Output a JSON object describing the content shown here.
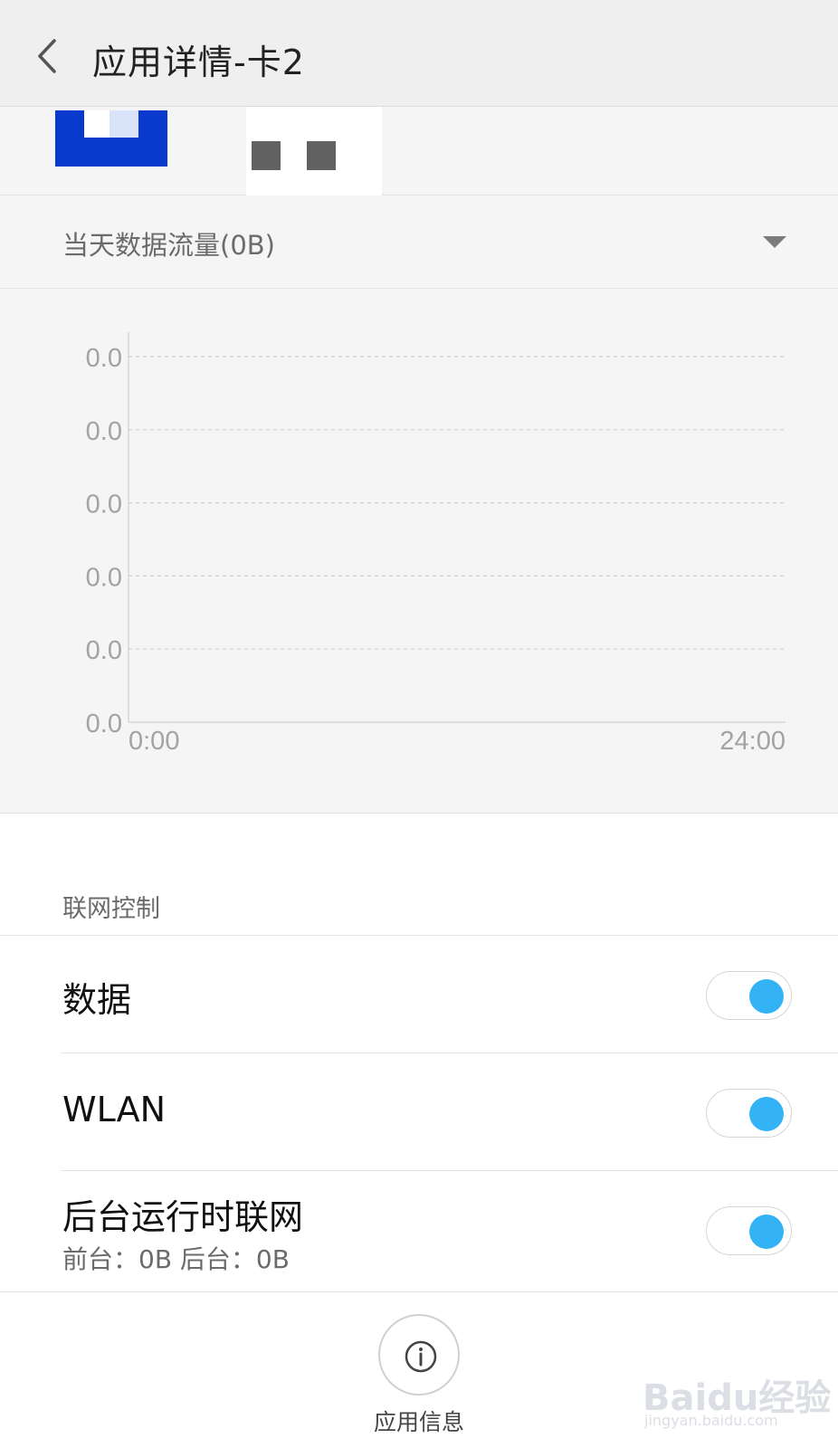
{
  "header": {
    "title": "应用详情-卡2",
    "back_icon": "chevron-left-icon"
  },
  "usage": {
    "range_label": "当天数据流量(0B)",
    "dropdown_icon": "triangle-down-icon"
  },
  "chart_data": {
    "type": "line",
    "title": "",
    "xlabel": "",
    "ylabel": "",
    "y_tick_labels": [
      "0.0",
      "0.0",
      "0.0",
      "0.0",
      "0.0",
      "0.0"
    ],
    "x_tick_labels": [
      "0:00",
      "24:00"
    ],
    "x": [
      "0:00",
      "24:00"
    ],
    "series": [
      {
        "values": [
          0,
          0
        ]
      }
    ],
    "ylim": [
      0,
      0
    ],
    "grid": true
  },
  "network_control": {
    "section_title": "联网控制",
    "items": [
      {
        "label": "数据",
        "enabled": true
      },
      {
        "label": "WLAN",
        "enabled": true
      },
      {
        "label": "后台运行时联网",
        "sub": "前台：0B  后台：0B",
        "enabled": true
      }
    ]
  },
  "footer": {
    "info_label": "应用信息",
    "info_icon": "info-circle-icon"
  },
  "watermark": {
    "logo": "Baidu经验",
    "url": "jingyan.baidu.com"
  },
  "colors": {
    "accent": "#33b3f6",
    "app_icon": "#0a39cd",
    "background": "#f5f5f5"
  }
}
